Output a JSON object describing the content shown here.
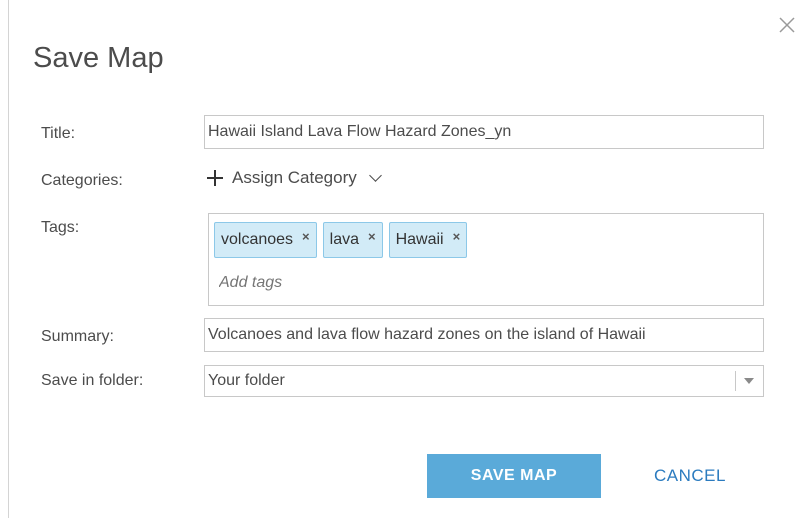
{
  "dialog": {
    "title": "Save Map",
    "close_icon": "close-icon"
  },
  "form": {
    "title_label": "Title:",
    "title_value": "Hawaii Island Lava Flow Hazard Zones_yn",
    "categories_label": "Categories:",
    "assign_category_label": "Assign Category",
    "tags_label": "Tags:",
    "tags": [
      {
        "label": "volcanoes"
      },
      {
        "label": "lava"
      },
      {
        "label": "Hawaii"
      }
    ],
    "tags_remove_symbol": "×",
    "tags_placeholder": "Add tags",
    "summary_label": "Summary:",
    "summary_value": "Volcanoes and lava flow hazard zones on the island of Hawaii",
    "folder_label": "Save in folder:",
    "folder_value": "Your folder"
  },
  "actions": {
    "save_label": "SAVE MAP",
    "cancel_label": "CANCEL"
  },
  "colors": {
    "primary_button": "#5aaad9",
    "link": "#2b7bbf",
    "tag_background": "#d2ebf7",
    "tag_border": "#8cc8e8"
  }
}
